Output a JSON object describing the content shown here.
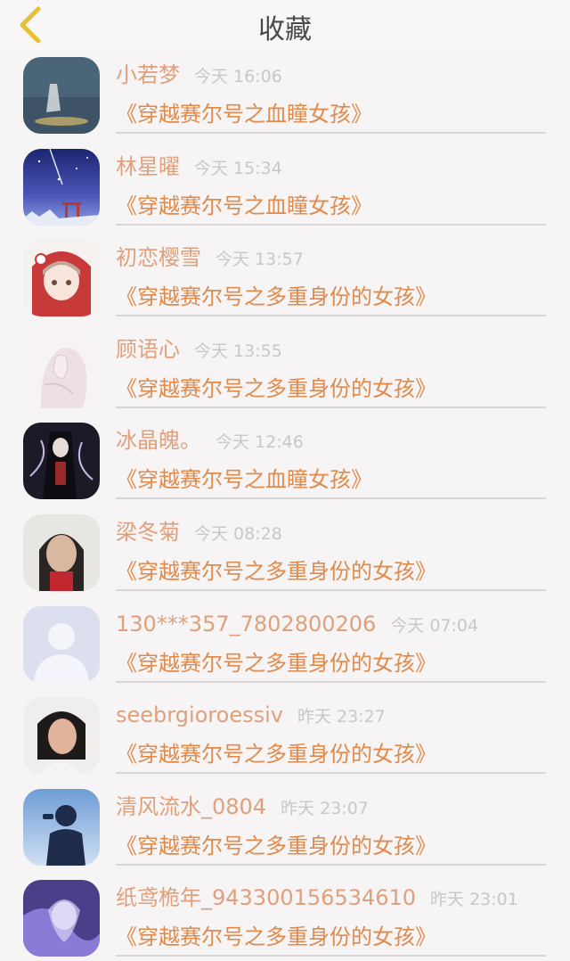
{
  "header": {
    "title": "收藏",
    "back_icon": "chevron-left-icon",
    "accent_color": "#e8c033"
  },
  "colors": {
    "name": "#e0a07c",
    "book": "#e08a4c",
    "time": "#c8c8c8"
  },
  "items": [
    {
      "name": "小若梦",
      "time": "今天 16:06",
      "book": "《穿越赛尔号之血瞳女孩》",
      "avatar": "moon-girl-avatar"
    },
    {
      "name": "林星曜",
      "time": "今天 15:34",
      "book": "《穿越赛尔号之血瞳女孩》",
      "avatar": "night-sky-avatar"
    },
    {
      "name": "初恋樱雪",
      "time": "今天 13:57",
      "book": "《穿越赛尔号之多重身份的女孩》",
      "avatar": "anime-girl-avatar"
    },
    {
      "name": "顾语心",
      "time": "今天 13:55",
      "book": "《穿越赛尔号之多重身份的女孩》",
      "avatar": "sketch-girl-avatar"
    },
    {
      "name": "冰晶魄。",
      "time": "今天 12:46",
      "book": "《穿越赛尔号之血瞳女孩》",
      "avatar": "dark-fantasy-avatar"
    },
    {
      "name": "梁冬菊",
      "time": "今天 08:28",
      "book": "《穿越赛尔号之多重身份的女孩》",
      "avatar": "photo-person-avatar"
    },
    {
      "name": "130***357_7802800206",
      "time": "今天 07:04",
      "book": "《穿越赛尔号之多重身份的女孩》",
      "avatar": "default-user-avatar"
    },
    {
      "name": "seebrgioroessiv",
      "time": "昨天 23:27",
      "book": "《穿越赛尔号之多重身份的女孩》",
      "avatar": "photo-person-avatar"
    },
    {
      "name": "清风流水_0804",
      "time": "昨天 23:07",
      "book": "《穿越赛尔号之多重身份的女孩》",
      "avatar": "silhouette-avatar"
    },
    {
      "name": "纸鸢桅年_943300156534610",
      "time": "昨天 23:01",
      "book": "《穿越赛尔号之多重身份的女孩》",
      "avatar": "purple-anime-avatar"
    }
  ]
}
